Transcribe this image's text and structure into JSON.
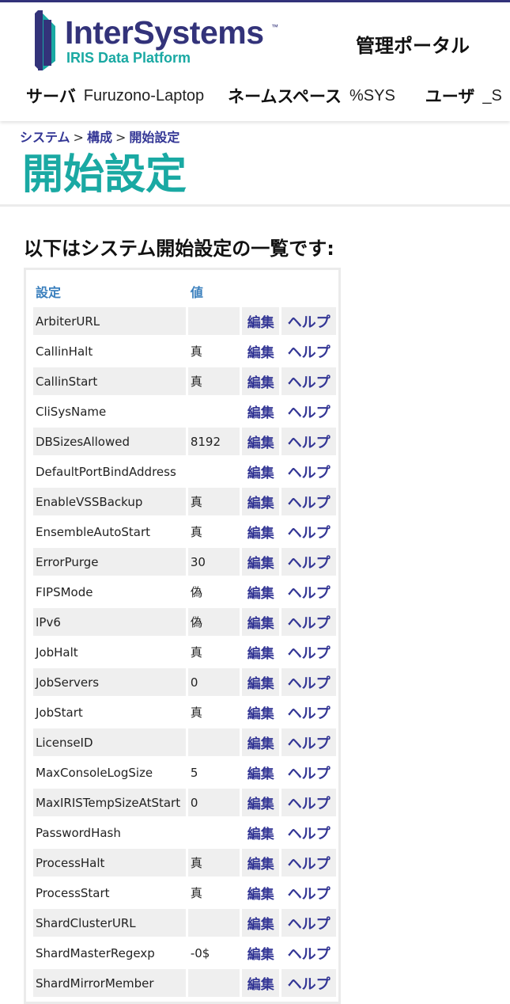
{
  "header": {
    "logo_main": "InterSystems",
    "logo_tm": "™",
    "logo_sub": "IRIS Data Platform",
    "portal_title": "管理ポータル",
    "server_label": "サーバ",
    "server_value": "Furuzono-Laptop",
    "namespace_label": "ネームスペース",
    "namespace_value": "%SYS",
    "user_label": "ユーザ",
    "user_value": "_S"
  },
  "breadcrumb": {
    "items": [
      "システム",
      "構成",
      "開始設定"
    ],
    "separator": ">"
  },
  "page_title": "開始設定",
  "intro_text": "以下はシステム開始設定の一覧です:",
  "table": {
    "headers": {
      "setting": "設定",
      "value": "値"
    },
    "edit_label": "編集",
    "help_label": "ヘルプ",
    "rows": [
      {
        "name": "ArbiterURL",
        "value": ""
      },
      {
        "name": "CallinHalt",
        "value": "真"
      },
      {
        "name": "CallinStart",
        "value": "真"
      },
      {
        "name": "CliSysName",
        "value": ""
      },
      {
        "name": "DBSizesAllowed",
        "value": "8192"
      },
      {
        "name": "DefaultPortBindAddress",
        "value": ""
      },
      {
        "name": "EnableVSSBackup",
        "value": "真"
      },
      {
        "name": "EnsembleAutoStart",
        "value": "真"
      },
      {
        "name": "ErrorPurge",
        "value": "30"
      },
      {
        "name": "FIPSMode",
        "value": "偽"
      },
      {
        "name": "IPv6",
        "value": "偽"
      },
      {
        "name": "JobHalt",
        "value": "真"
      },
      {
        "name": "JobServers",
        "value": "0"
      },
      {
        "name": "JobStart",
        "value": "真"
      },
      {
        "name": "LicenseID",
        "value": ""
      },
      {
        "name": "MaxConsoleLogSize",
        "value": "5"
      },
      {
        "name": "MaxIRISTempSizeAtStart",
        "value": "0"
      },
      {
        "name": "PasswordHash",
        "value": ""
      },
      {
        "name": "ProcessHalt",
        "value": "真"
      },
      {
        "name": "ProcessStart",
        "value": "真"
      },
      {
        "name": "ShardClusterURL",
        "value": ""
      },
      {
        "name": "ShardMasterRegexp",
        "value": "-0$"
      },
      {
        "name": "ShardMirrorMember",
        "value": ""
      }
    ]
  },
  "colors": {
    "brand_navy": "#33337a",
    "brand_teal": "#1aa9a3",
    "link": "#333695",
    "header_blue": "#3a7fbd"
  }
}
